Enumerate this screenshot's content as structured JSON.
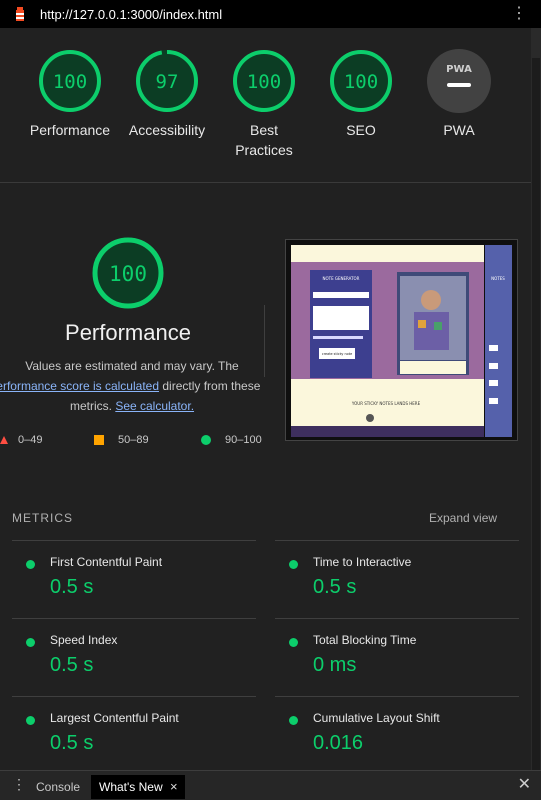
{
  "browser": {
    "url": "http://127.0.0.1:3000/index.html"
  },
  "scores": [
    {
      "label": "Performance",
      "value": "100",
      "percent": 1.0
    },
    {
      "label": "Accessibility",
      "value": "97",
      "percent": 0.97
    },
    {
      "label": "Best Practices",
      "value": "100",
      "percent": 1.0
    },
    {
      "label": "SEO",
      "value": "100",
      "percent": 1.0
    },
    {
      "label": "PWA",
      "value": "PWA"
    }
  ],
  "performance": {
    "score": "100",
    "title": "Performance",
    "desc_1": "Values are estimated and may vary. The",
    "desc_link_1": "performance score is calculated",
    "desc_2": "directly from these",
    "desc_3": "metrics.",
    "desc_link_2": "See calculator."
  },
  "legend": [
    {
      "range": "0–49",
      "color": "#ff4e42"
    },
    {
      "range": "50–89",
      "color": "#ffa400"
    },
    {
      "range": "90–100",
      "color": "#0cce6b"
    }
  ],
  "metrics": {
    "heading": "METRICS",
    "expand_label": "Expand view",
    "items": [
      {
        "name": "First Contentful Paint",
        "value": "0.5 s"
      },
      {
        "name": "Time to Interactive",
        "value": "0.5 s"
      },
      {
        "name": "Speed Index",
        "value": "0.5 s"
      },
      {
        "name": "Total Blocking Time",
        "value": "0 ms"
      },
      {
        "name": "Largest Contentful Paint",
        "value": "0.5 s"
      },
      {
        "name": "Cumulative Layout Shift",
        "value": "0.016"
      }
    ]
  },
  "thumbnail": {
    "header": "NOTE GENERATOR",
    "side_title": "NOTES",
    "caption": "YOUR STICKY NOTES LANDS HERE",
    "button": "create sticky note"
  },
  "drawer": {
    "tabs": [
      {
        "label": "Console"
      },
      {
        "label": "What's New"
      }
    ]
  },
  "colors": {
    "pass": "#0cce6b",
    "average": "#ffa400",
    "fail": "#ff4e42",
    "link": "#8ab4f8"
  }
}
